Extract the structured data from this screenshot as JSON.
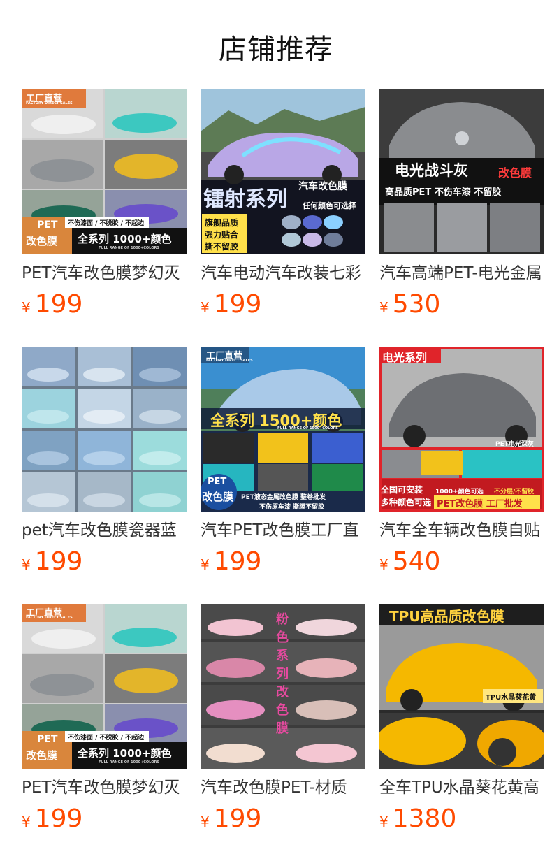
{
  "page": {
    "title": "店铺推荐"
  },
  "products": [
    {
      "name": "PET汽车改色膜梦幻灭",
      "currency": "¥",
      "price": "199",
      "overlay": {
        "badge_line1": "工厂直营",
        "badge_line2": "FACTORY DIRECT SALES",
        "tag1": "PET",
        "tag2": "改色膜",
        "strip": "不伤漆面 / 不脱胶 / 不起边",
        "series": "全系列 1000+颜色",
        "fine": "FULL RANGE OF 1000+COLORS"
      },
      "colors": {
        "bg": "#cfcfcf",
        "c1": "#e8e8e8",
        "c2": "#3cc8c0",
        "c3": "#8e9296",
        "c4": "#e3b52a",
        "c5": "#1f6a55",
        "c6": "#6a52c8"
      }
    },
    {
      "name": "汽车电动汽车改装七彩",
      "currency": "¥",
      "price": "199",
      "overlay": {
        "big": "镭射系列",
        "side": "汽车改色膜",
        "any": "任何颜色可选择",
        "tag1": "旗舰品质",
        "tag2": "强力贴合",
        "tag3": "撕不留胶"
      },
      "colors": {
        "sky": "#9fc4dc",
        "hill": "#5d7b55",
        "car": "#b9a7e6",
        "dark": "#121420"
      }
    },
    {
      "name": "汽车高端PET-电光金属",
      "currency": "¥",
      "price": "530",
      "overlay": {
        "head": "电光战斗灰",
        "tag": "改色膜",
        "sub": "高品质PET  不伤车漆  不留胶"
      },
      "colors": {
        "car": "#8a8c8f",
        "bg": "#2a2a2a",
        "accent": "#ff3b3b"
      }
    },
    {
      "name": "pet汽车改色膜瓷器蓝",
      "currency": "¥",
      "price": "199",
      "overlay": {},
      "colors": {
        "a": "#8fa9c8",
        "b": "#a9bfd6",
        "c": "#6f8fb3",
        "d": "#9cd3de",
        "e": "#c4d6e6",
        "f": "#9ab2c9"
      }
    },
    {
      "name": "汽车PET改色膜工厂直",
      "currency": "¥",
      "price": "199",
      "overlay": {
        "badge_line1": "工厂直营",
        "badge_line2": "FACTORY DIRECT SALES",
        "series": "全系列 1500+颜色",
        "fine": "FULL RANGE OF 1500+COLORS",
        "tag1": "PET",
        "tag2": "改色膜",
        "strip": "PET液态金属改色膜 整卷批发",
        "strip2": "不伤原车漆 撕膜不留胶"
      },
      "colors": {
        "sky": "#3a8fd0",
        "car": "#a9c9e8",
        "strip": "#1a2a4a",
        "yellow": "#ffe04a"
      }
    },
    {
      "name": "汽车全车辆改色膜自贴",
      "currency": "¥",
      "price": "540",
      "overlay": {
        "head": "电光系列",
        "tag": "PET电光深灰",
        "l1": "全国可安装",
        "l2": "多种颜色可选",
        "b1": "1000+颜色可选",
        "b2": "不分层/不留胶",
        "b3": "PET改色膜 工厂批发"
      },
      "colors": {
        "red": "#e0242a",
        "car": "#6d6f73",
        "floor": "#b5b5b5"
      }
    },
    {
      "name": "PET汽车改色膜梦幻灭",
      "currency": "¥",
      "price": "199",
      "overlay": {
        "badge_line1": "工厂直营",
        "badge_line2": "FACTORY DIRECT SALES",
        "tag1": "PET",
        "tag2": "改色膜",
        "strip": "不伤漆面 / 不脱胶 / 不起边",
        "series": "全系列 1000+颜色",
        "fine": "FULL RANGE OF 1000+COLORS"
      },
      "colors": {
        "bg": "#cfcfcf",
        "c1": "#e8e8e8",
        "c2": "#3cc8c0",
        "c3": "#8e9296",
        "c4": "#e3b52a",
        "c5": "#1f6a55",
        "c6": "#6a52c8"
      }
    },
    {
      "name": "汽车改色膜PET-材质",
      "currency": "¥",
      "price": "199",
      "overlay": {
        "vertical": "粉色系列改色膜"
      },
      "colors": {
        "bg": "#3c3c3c",
        "p1": "#f2c4d2",
        "p2": "#d987a8",
        "p3": "#f0d6dc",
        "p4": "#e7b3b9"
      }
    },
    {
      "name": "全车TPU水晶葵花黄高",
      "currency": "¥",
      "price": "1380",
      "overlay": {
        "head": "TPU高品质改色膜",
        "tag": "TPU水晶葵花黄"
      },
      "colors": {
        "yellow": "#f5b800",
        "bg": "#2b2b2b",
        "head": "#ffd23f"
      }
    }
  ]
}
